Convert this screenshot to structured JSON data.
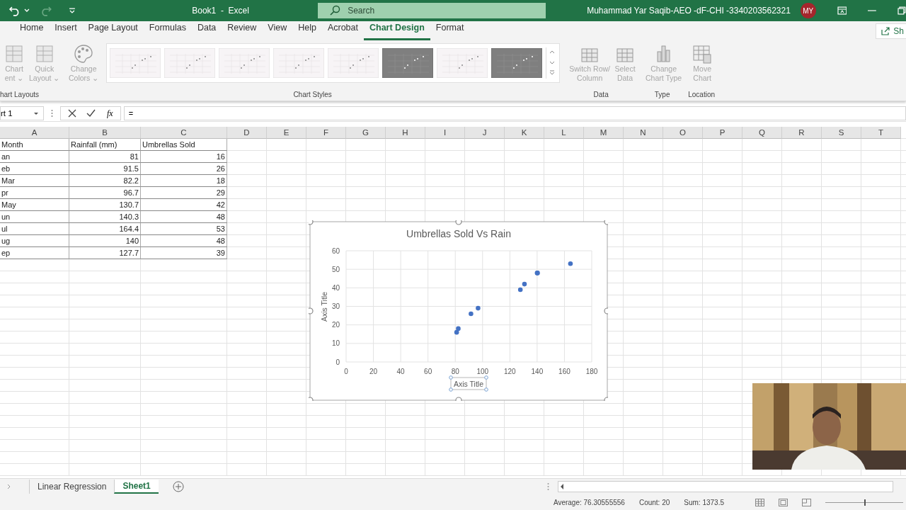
{
  "title_bar": {
    "title": "Book1  -  Excel",
    "search_placeholder": "Search",
    "user": "Muhammad Yar Saqib-AEO -dF-CHI -3340203562321",
    "avatar": "MY"
  },
  "ribbon_tabs": [
    {
      "label": "Home",
      "selected": false
    },
    {
      "label": "Insert",
      "selected": false
    },
    {
      "label": "Page Layout",
      "selected": false
    },
    {
      "label": "Formulas",
      "selected": false
    },
    {
      "label": "Data",
      "selected": false
    },
    {
      "label": "Review",
      "selected": false
    },
    {
      "label": "View",
      "selected": false
    },
    {
      "label": "Help",
      "selected": false
    },
    {
      "label": "Acrobat",
      "selected": false
    },
    {
      "label": "Chart Design",
      "selected": true
    },
    {
      "label": "Format",
      "selected": false
    }
  ],
  "share": "Sh",
  "ribbon": {
    "layouts_group": "hart Layouts",
    "layout_buttons": [
      {
        "lines": [
          "Chart",
          "ent ⌄"
        ]
      },
      {
        "lines": [
          "Quick",
          "Layout ⌄"
        ]
      }
    ],
    "colors_button": [
      "Change",
      "Colors ⌄"
    ],
    "styles_group": "Chart Styles",
    "styles": [
      {
        "kind": "light"
      },
      {
        "kind": "light"
      },
      {
        "kind": "light"
      },
      {
        "kind": "light"
      },
      {
        "kind": "light"
      },
      {
        "kind": "dark"
      },
      {
        "kind": "light"
      },
      {
        "kind": "dark"
      }
    ],
    "data_group": "Data",
    "data_buttons": [
      {
        "lines": [
          "Switch Row/",
          "Column"
        ]
      },
      {
        "lines": [
          "Select",
          "Data"
        ]
      }
    ],
    "type_group": "Type",
    "type_button": [
      "Change",
      "Chart Type"
    ],
    "location_group": "Location",
    "location_button": [
      "Move",
      "Chart"
    ]
  },
  "formula_bar": {
    "name_box": "rt 1",
    "fx": "fx",
    "value": "="
  },
  "columns": [
    "A",
    "B",
    "C",
    "D",
    "E",
    "F",
    "G",
    "H",
    "I",
    "J",
    "K",
    "L",
    "M",
    "N",
    "O",
    "P",
    "Q",
    "R",
    "S",
    "T"
  ],
  "table": {
    "header": [
      "Month",
      "Rainfall (mm)",
      "Umbrellas Sold"
    ],
    "rows": [
      [
        "an",
        "81",
        "16"
      ],
      [
        "eb",
        "91.5",
        "26"
      ],
      [
        "Mar",
        "82.2",
        "18"
      ],
      [
        "pr",
        "96.7",
        "29"
      ],
      [
        "May",
        "130.7",
        "42"
      ],
      [
        "un",
        "140.3",
        "48"
      ],
      [
        "ul",
        "164.4",
        "53"
      ],
      [
        "ug",
        "140",
        "48"
      ],
      [
        "ep",
        "127.7",
        "39"
      ]
    ]
  },
  "chart": {
    "chart_data": {
      "type": "scatter",
      "title": "Umbrellas Sold Vs Rain",
      "xlabel": "Axis Title",
      "ylabel": "Axis Title",
      "x": [
        81,
        91.5,
        82.2,
        96.7,
        130.7,
        140.3,
        164.4,
        140,
        127.7
      ],
      "series": [
        {
          "color": "#4472c4",
          "values": [
            16,
            26,
            18,
            29,
            42,
            48,
            53,
            48,
            39
          ]
        }
      ],
      "grid": true,
      "xlim": [
        0,
        180
      ],
      "ylim": [
        0,
        60
      ],
      "xticks": [
        0,
        20,
        40,
        60,
        80,
        100,
        120,
        140,
        160,
        180
      ],
      "yticks": [
        0,
        10,
        20,
        30,
        40,
        50,
        60
      ]
    }
  },
  "sheet_tabs": [
    {
      "label": "Linear Regression",
      "selected": false
    },
    {
      "label": "Sheet1",
      "selected": true
    }
  ],
  "status_bar": {
    "average": "Average: 76.30555556",
    "count": "Count: 20",
    "sum": "Sum: 1373.5",
    "zoom_slider": {
      "level": 0.5
    }
  }
}
